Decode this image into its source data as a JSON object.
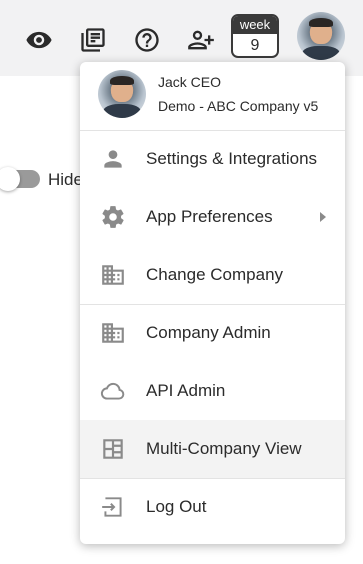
{
  "topbar": {
    "icons": [
      "eye-icon",
      "notebook-icon",
      "help-icon",
      "add-user-icon"
    ],
    "week": {
      "label": "week",
      "number": "9"
    }
  },
  "background": {
    "toggle_label": "Hide"
  },
  "menu": {
    "user": {
      "name": "Jack CEO",
      "company": "Demo - ABC Company v5"
    },
    "items": [
      {
        "label": "Settings & Integrations",
        "icon": "person-icon"
      },
      {
        "label": "App Preferences",
        "icon": "gear-icon"
      },
      {
        "label": "Change Company",
        "icon": "building-icon"
      },
      {
        "label": "Company Admin",
        "icon": "building-icon"
      },
      {
        "label": "API Admin",
        "icon": "cloud-icon"
      },
      {
        "label": "Multi-Company View",
        "icon": "grid-icon"
      },
      {
        "label": "Log Out",
        "icon": "logout-icon"
      }
    ]
  },
  "colors": {
    "topbar_bg": "#f2f2f3",
    "icon": "#3a3a3a",
    "menu_icon": "#8a8a8a",
    "highlight": "#f3f3f3"
  }
}
